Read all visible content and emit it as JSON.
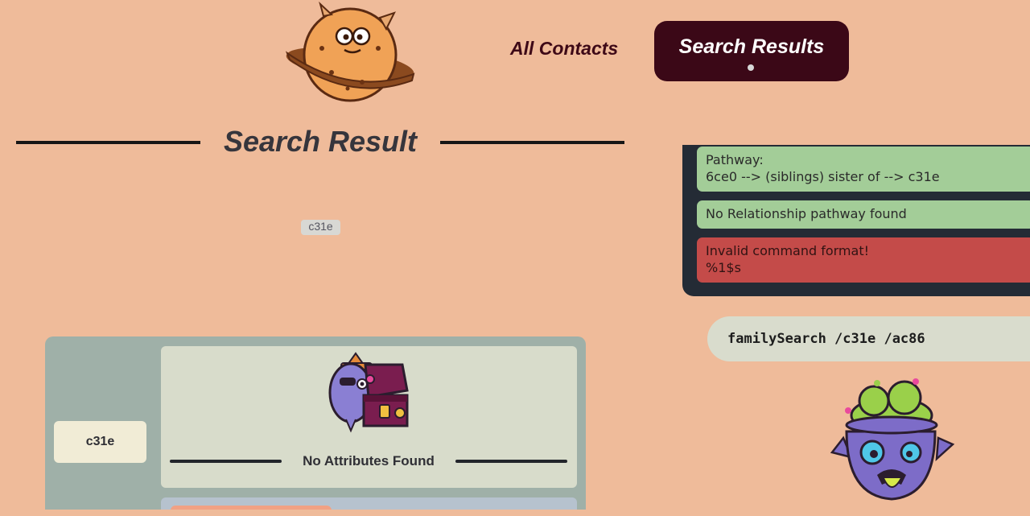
{
  "header": {
    "nav": {
      "all_contacts": "All Contacts",
      "search_results": "Search Results"
    }
  },
  "main": {
    "title": "Search Result",
    "graph_node": "c31e",
    "result": {
      "member": "c31e",
      "attributes_message": "No Attributes Found"
    }
  },
  "console": {
    "messages": [
      {
        "line1": "Pathway:",
        "line2": "6ce0 --> (siblings) sister of  --> c31e",
        "status": "success"
      },
      {
        "line1": "No Relationship pathway found",
        "status": "success"
      },
      {
        "line1": "Invalid command format!",
        "line2": "%1$s",
        "status": "error"
      }
    ],
    "command": "familySearch /c31e /ac86"
  },
  "colors": {
    "background": "#efbb9a",
    "nav_active": "#3b0817",
    "success": "#a3cd98",
    "error": "#c44b49",
    "console_bg": "#242b35"
  },
  "icons": {
    "logo": "planet-cookie-logo-icon",
    "empty_state": "pirate-treasure-chest-icon",
    "mascot": "404-zombie-monster-icon"
  }
}
